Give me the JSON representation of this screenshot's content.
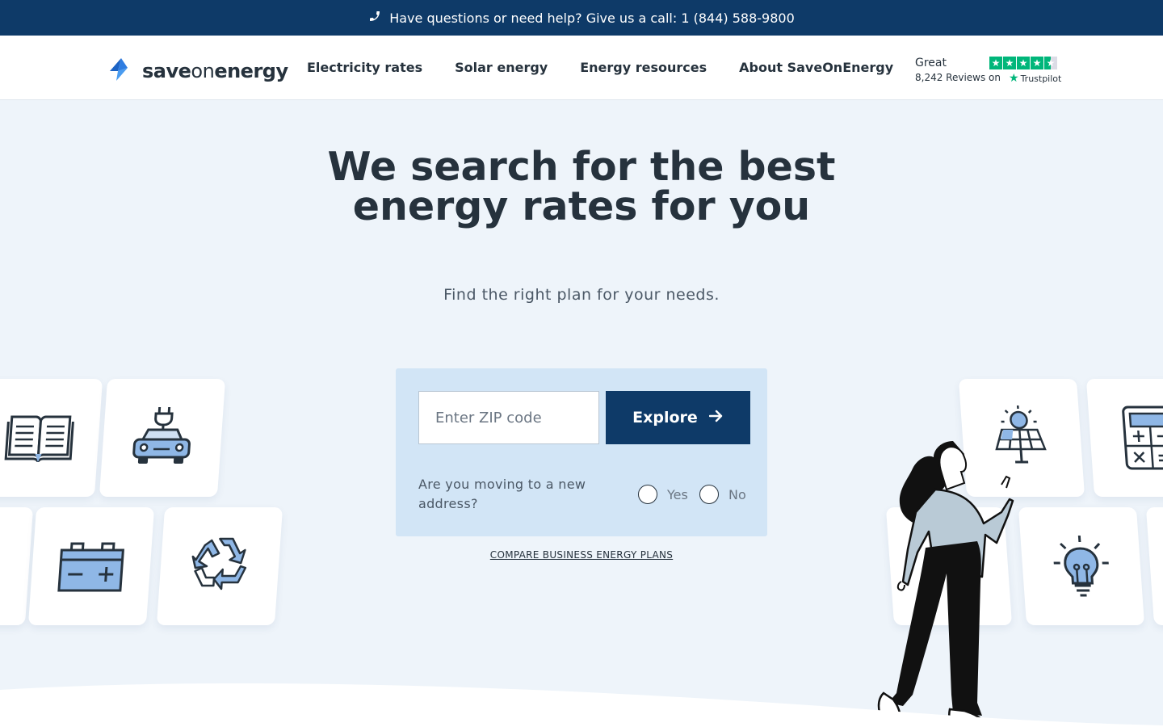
{
  "topbar": {
    "text": "Have questions or need help? Give us a call: 1 (844) 588-9800",
    "icon": "phone-icon"
  },
  "logo": {
    "part1": "save",
    "part2": "on",
    "part3": "energy",
    "icon": "lightning-logo-icon"
  },
  "nav": {
    "items": [
      "Electricity rates",
      "Solar energy",
      "Energy resources",
      "About SaveOnEnergy"
    ]
  },
  "trustpilot": {
    "rating_word": "Great",
    "reviews": "8,242 Reviews on",
    "brand": "Trustpilot",
    "stars": 4.5
  },
  "hero": {
    "title": "We search for the best energy rates for you",
    "subtitle": "Find the right plan for your needs."
  },
  "search": {
    "zip_placeholder": "Enter ZIP code",
    "explore_label": "Explore",
    "moving_question": "Are you moving to a new address?",
    "yes_label": "Yes",
    "no_label": "No",
    "business_link": "COMPARE BUSINESS ENERGY PLANS"
  },
  "tiles": [
    "book-icon",
    "electric-car-icon",
    "battery-icon",
    "recycle-icon",
    "solar-panel-icon",
    "calculator-icon",
    "lightbulb-icon"
  ],
  "colors": {
    "primary": "#0e3a68",
    "accent": "#2f7de1",
    "background": "#eef4fa",
    "search_bg": "#d2e5f6",
    "trustpilot": "#00b67a"
  }
}
